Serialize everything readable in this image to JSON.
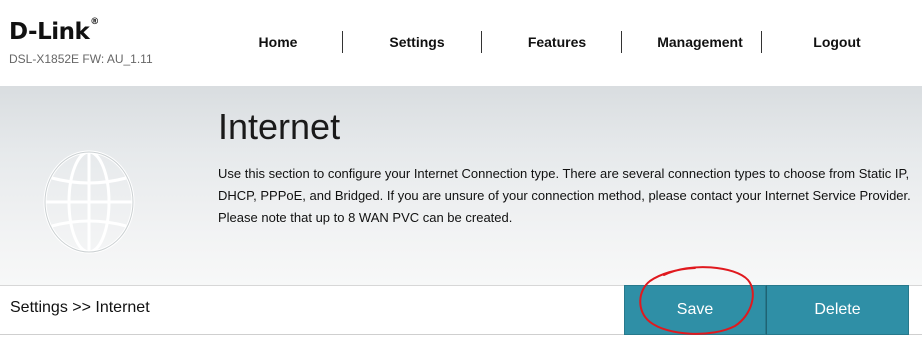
{
  "brand": {
    "logo": "D-Link",
    "reg": "®",
    "model_info": "DSL-X1852E   FW: AU_1.11"
  },
  "nav": {
    "items": [
      {
        "label": "Home"
      },
      {
        "label": "Settings"
      },
      {
        "label": "Features"
      },
      {
        "label": "Management"
      },
      {
        "label": "Logout"
      }
    ]
  },
  "hero": {
    "icon": "globe-icon",
    "title": "Internet",
    "description": "Use this section to configure your Internet Connection type. There are several connection types to choose from Static IP, DHCP, PPPoE, and Bridged. If you are unsure of your connection method, please contact your Internet Service Provider. Please note that up to 8 WAN PVC can be created."
  },
  "bottom": {
    "breadcrumb": "Settings >> Internet",
    "save_label": "Save",
    "delete_label": "Delete"
  },
  "colors": {
    "button": "#2f8fa6",
    "annotation": "#e0191e"
  }
}
